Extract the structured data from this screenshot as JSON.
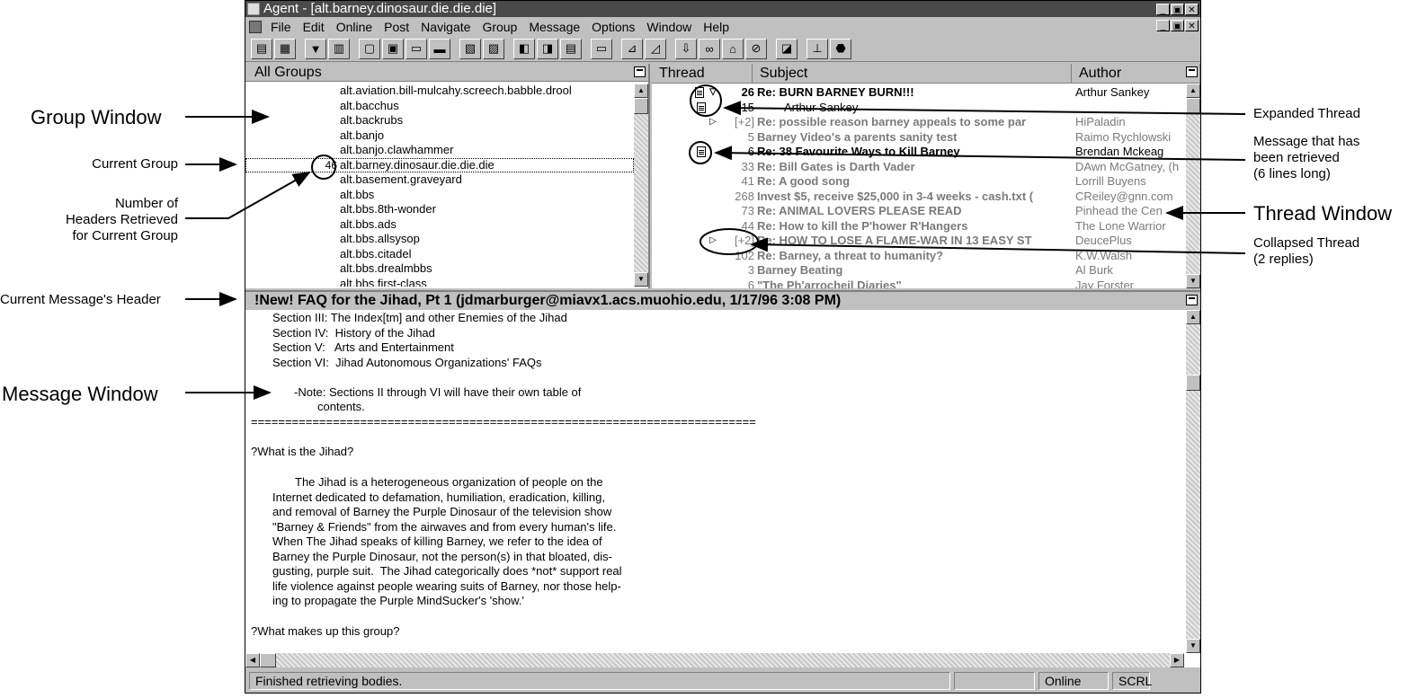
{
  "window": {
    "title": "Agent - [alt.barney.dinosaur.die.die.die]",
    "controls": [
      "_",
      "▣",
      "✕"
    ]
  },
  "menu": [
    "File",
    "Edit",
    "Online",
    "Post",
    "Navigate",
    "Group",
    "Message",
    "Options",
    "Window",
    "Help"
  ],
  "toolbar": {
    "icons": [
      "get-new-headers-icon",
      "get-marked-bodies-icon",
      "filter-icon",
      "purge-icon",
      "new-message-icon",
      "reply-icon",
      "follow-up-icon",
      "forward-icon",
      "retrieve-icon",
      "mark-icon",
      "prev-icon",
      "next-icon",
      "thread-icon",
      "print-icon",
      "keep-icon",
      "watch-icon",
      "ignore-icon",
      "delete-icon",
      "mark-read-icon",
      "properties-icon",
      "online-icon",
      "stop-icon"
    ]
  },
  "groups": {
    "header": "All Groups",
    "items": [
      {
        "name": "alt.aviation.bill-mulcahy.screech.babble.drool",
        "count": ""
      },
      {
        "name": "alt.bacchus",
        "count": ""
      },
      {
        "name": "alt.backrubs",
        "count": ""
      },
      {
        "name": "alt.banjo",
        "count": ""
      },
      {
        "name": "alt.banjo.clawhammer",
        "count": ""
      },
      {
        "name": "alt.barney.dinosaur.die.die.die",
        "count": "46"
      },
      {
        "name": "alt.basement.graveyard",
        "count": ""
      },
      {
        "name": "alt.bbs",
        "count": ""
      },
      {
        "name": "alt.bbs.8th-wonder",
        "count": ""
      },
      {
        "name": "alt.bbs.ads",
        "count": ""
      },
      {
        "name": "alt.bbs.allsysop",
        "count": ""
      },
      {
        "name": "alt.bbs.citadel",
        "count": ""
      },
      {
        "name": "alt.bbs.drealmbbs",
        "count": ""
      },
      {
        "name": "alt.bbs.first-class",
        "count": ""
      }
    ]
  },
  "threads": {
    "columns": [
      "Thread",
      "Subject",
      "Author"
    ],
    "rows": [
      {
        "marker": "▽",
        "lines": "26",
        "subject": "Re: BURN BARNEY BURN!!!",
        "author": "Arthur Sankey"
      },
      {
        "marker": "",
        "lines": "15",
        "subject": "Arthur Sankey",
        "author": ""
      },
      {
        "marker": "▷",
        "lines": "[+2]",
        "subject": "Re: possible reason barney appeals to some par",
        "author": "HiPaladin"
      },
      {
        "marker": "",
        "lines": "5",
        "subject": "Barney Video's a parents sanity test",
        "author": "Raimo Rychlowski"
      },
      {
        "marker": "",
        "lines": "6",
        "subject": "Re: 38 Favourite Ways to Kill Barney",
        "author": "Brendan Mckeag"
      },
      {
        "marker": "",
        "lines": "33",
        "subject": "Re: Bill Gates is Darth Vader",
        "author": "DAwn McGatney, (h"
      },
      {
        "marker": "",
        "lines": "41",
        "subject": "Re: A good song",
        "author": "Lorrill Buyens"
      },
      {
        "marker": "",
        "lines": "268",
        "subject": "Invest $5, receive $25,000 in 3-4 weeks - cash.txt (",
        "author": "CReiley@gnn.com"
      },
      {
        "marker": "",
        "lines": "73",
        "subject": "Re: ANIMAL LOVERS PLEASE READ",
        "author": "Pinhead the Cen"
      },
      {
        "marker": "",
        "lines": "44",
        "subject": "Re: How to kill the P'hower R'Hangers",
        "author": "The Lone Warrior"
      },
      {
        "marker": "▷",
        "lines": "[+2]",
        "subject": "Re: HOW TO LOSE A FLAME-WAR IN 13 EASY ST",
        "author": "DeucePlus"
      },
      {
        "marker": "",
        "lines": "102",
        "subject": "Re: Barney, a threat to humanity?",
        "author": "K.W.Walsh"
      },
      {
        "marker": "",
        "lines": "3",
        "subject": "Barney Beating",
        "author": "Al Burk"
      },
      {
        "marker": "",
        "lines": "6",
        "subject": "\"The Ph'arrocheil Diaries\"",
        "author": "Jay Forster"
      }
    ]
  },
  "message": {
    "header": "!New! FAQ for the Jihad, Pt 1 (jdmarburger@miavx1.acs.muohio.edu, 1/17/96 3:08 PM)",
    "lines": [
      "Section III: The Index[tm] and other Enemies of the Jihad",
      "Section IV:  History of the Jihad",
      "Section V:   Arts and Entertainment",
      "Section VI:  Jihad Autonomous Organizations' FAQs",
      "",
      "-Note: Sections II through VI will have their own table of",
      "contents.",
      "==========================================================================",
      "",
      "?What is the Jihad?",
      "",
      "The Jihad is a heterogeneous organization of people on the",
      "Internet dedicated to defamation, humiliation, eradication, killing,",
      "and removal of Barney the Purple Dinosaur of the television show",
      "\"Barney & Friends\" from the airwaves and from every human's life.",
      "When The Jihad speaks of killing Barney, we refer to the idea of",
      "Barney the Purple Dinosaur, not the person(s) in that bloated, dis-",
      "gusting, purple suit.  The Jihad categorically does *not* support real",
      "life violence against people wearing suits of Barney, nor those help-",
      "ing to propagate the Purple MindSucker's 'show.'",
      "",
      "?What makes up this group?"
    ]
  },
  "status": {
    "message": "Finished retrieving bodies.",
    "online": "Online",
    "scroll": "SCRL"
  },
  "callouts": {
    "group_window": "Group Window",
    "current_group": "Current Group",
    "number_headers": [
      "Number of",
      "Headers Retrieved",
      "for Current Group"
    ],
    "current_header": "Current Message's Header",
    "message_window": "Message Window",
    "expanded_thread": "Expanded Thread",
    "retrieved": [
      "Message that has",
      "been retrieved",
      "(6 lines long)"
    ],
    "thread_window": "Thread Window",
    "collapsed_thread": [
      "Collapsed Thread",
      "(2 replies)"
    ]
  }
}
